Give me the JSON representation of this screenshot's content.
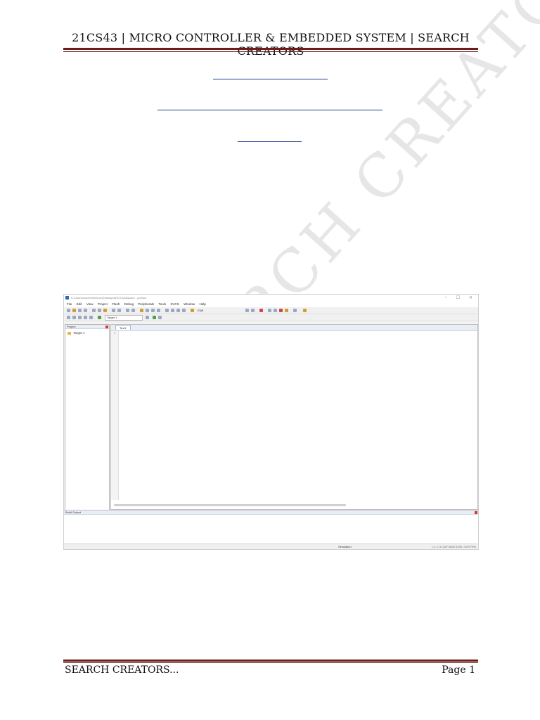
{
  "header": {
    "title": "21CS43 | MICRO CONTROLLER & EMBEDDED SYSTEM | SEARCH CREATORS"
  },
  "watermark": {
    "text": "SEARCH CREATORS"
  },
  "ide": {
    "title_bar": "C:\\Users\\unod\\OneDrive\\Desktop\\ARCS\\UM\\space - µVision",
    "window_controls": {
      "minimize": "–",
      "maximize": "☐",
      "close": "✕"
    },
    "menu": [
      "File",
      "Edit",
      "View",
      "Project",
      "Flash",
      "Debug",
      "Peripherals",
      "Tools",
      "SVCS",
      "Window",
      "Help"
    ],
    "toolbar_label": "ENB",
    "target_combo": "Target 1",
    "project_panel": {
      "title": "Project",
      "tree_item": "Target 1"
    },
    "panel_tabs": [
      "Pr...",
      "Bo...",
      "{} F...",
      "0... "
    ],
    "editor": {
      "tab": "Text1",
      "line_number": "1"
    },
    "build_output": {
      "title": "Build Output"
    },
    "status": {
      "mode": "Simulation",
      "cursor": "L:1 C:1  CAP  NUM  SCRL  OVR  R/W"
    }
  },
  "footer": {
    "left": "SEARCH CREATORS...",
    "right": "Page 1"
  }
}
